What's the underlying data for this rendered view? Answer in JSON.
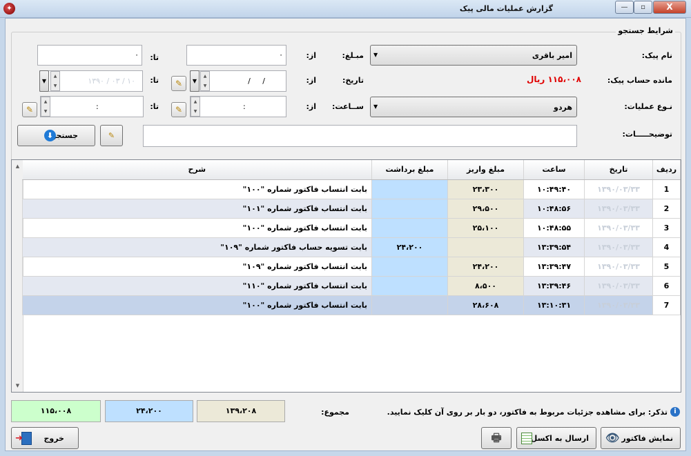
{
  "window": {
    "title": "گزارش عملیات مالی پیک",
    "minimize_glyph": "—",
    "restore_glyph": "▫",
    "close_glyph": "X"
  },
  "search": {
    "group_title": "شرایط جستجو",
    "courier_label": "نام پیک:",
    "courier_value": "امیر باقری",
    "balance_label": "مانده حساب پیک:",
    "balance_value": "۱۱۵،۰۰۸ ریال",
    "operation_label": "نـوع عملیات:",
    "operation_value": "هردو",
    "notes_label": "توضیحـــــات:",
    "amount_label": "مبـلغ:",
    "date_label": "تاریخ:",
    "time_label": "ســاعت:",
    "from_label": "از:",
    "to_label": "تا:",
    "amount_from": "۰",
    "amount_to": "۰",
    "date_from": "/     /",
    "date_to": "۱۳۹۰ / ۰۳ / ۱۰",
    "time_from": ":",
    "time_to": ":",
    "search_button": "جستجو"
  },
  "table": {
    "headers": [
      "ردیف",
      "تاریخ",
      "ساعت",
      "مبلغ واریز",
      "مبلغ برداشت",
      "شرح"
    ],
    "rows": [
      {
        "n": "1",
        "date": "۱۳۹۰/۰۳/۳۳",
        "time": "۱۰:۴۹:۴۰",
        "deposit": "۲۳،۳۰۰",
        "withdraw": "",
        "desc": "بابت انتساب فاکتور شماره \"۱۰۰\""
      },
      {
        "n": "2",
        "date": "۱۳۹۰/۰۳/۳۳",
        "time": "۱۰:۴۸:۵۶",
        "deposit": "۲۹،۵۰۰",
        "withdraw": "",
        "desc": "بابت انتساب فاکتور شماره \"۱۰۱\""
      },
      {
        "n": "3",
        "date": "۱۳۹۰/۰۳/۳۳",
        "time": "۱۰:۴۸:۵۵",
        "deposit": "۲۵،۱۰۰",
        "withdraw": "",
        "desc": "بابت انتساب فاکتور شماره \"۱۰۰\""
      },
      {
        "n": "4",
        "date": "۱۳۹۰/۰۳/۳۳",
        "time": "۱۳:۳۹:۵۴",
        "deposit": "",
        "withdraw": "۲۴،۲۰۰",
        "desc": "بابت تسویه حساب فاکتور شماره \"۱۰۹\""
      },
      {
        "n": "5",
        "date": "۱۳۹۰/۰۳/۳۳",
        "time": "۱۳:۳۹:۴۷",
        "deposit": "۲۴،۲۰۰",
        "withdraw": "",
        "desc": "بابت انتساب فاکتور شماره \"۱۰۹\""
      },
      {
        "n": "6",
        "date": "۱۳۹۰/۰۳/۳۳",
        "time": "۱۳:۳۹:۴۶",
        "deposit": "۸،۵۰۰",
        "withdraw": "",
        "desc": "بابت انتساب فاکتور شماره \"۱۱۰\""
      },
      {
        "n": "7",
        "date": "۱۳۹۰/۰۳/۳۳",
        "time": "۱۳:۱۰:۳۱",
        "deposit": "۲۸،۶۰۸",
        "withdraw": "",
        "desc": "بابت انتساب فاکتور شماره \"۱۰۰\""
      }
    ]
  },
  "footer": {
    "note": "تذکر: برای مشاهده جزئیات مربوط به فاکتور، دو بار بر روی آن کلیک نمایید.",
    "total_label": "مجموع:",
    "total_deposit": "۱۳۹،۲۰۸",
    "total_withdraw": "۲۴،۲۰۰",
    "total_balance": "۱۱۵،۰۰۸",
    "show_invoice_button": "نمایش فاکتور",
    "excel_button": "ارسال به اکسل",
    "exit_button": "خروج"
  },
  "colors": {
    "balance": "#e00000",
    "deposit_bg": "#ece9d8",
    "withdraw_bg": "#bee0ff",
    "balance_bg": "#ccffcc"
  }
}
